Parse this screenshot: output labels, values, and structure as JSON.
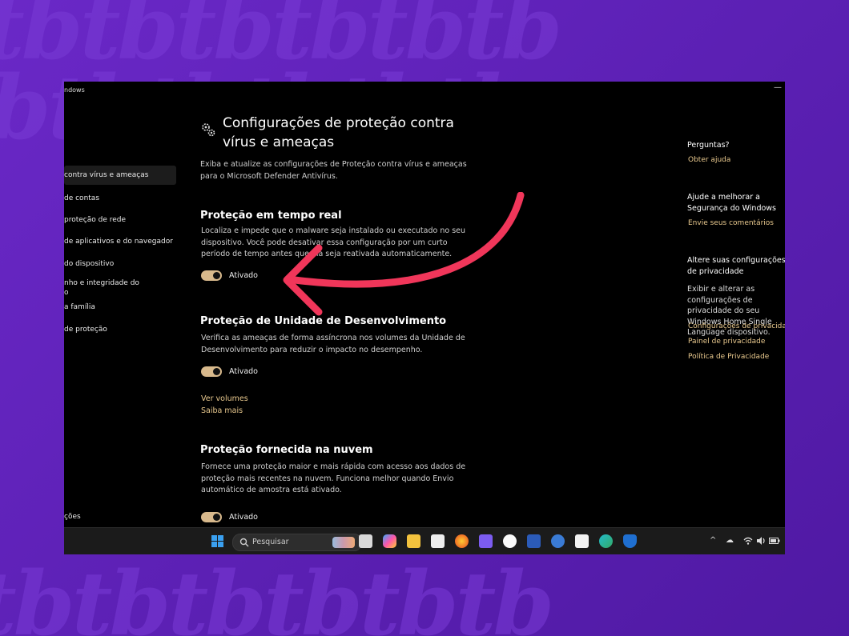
{
  "window": {
    "title": "ndows",
    "menu_glyph": "—"
  },
  "sidebar": {
    "items": [
      {
        "label": "contra vírus e ameaças",
        "active": true
      },
      {
        "label": "de contas"
      },
      {
        "label": "proteção de rede"
      },
      {
        "label": "de aplicativos e do navegador"
      },
      {
        "label": "do dispositivo"
      },
      {
        "label": "nho e integridade do o"
      },
      {
        "label": "a família"
      },
      {
        "label": "de proteção"
      }
    ],
    "bottom_item": "ções"
  },
  "main": {
    "title": "Configurações de proteção contra vírus e ameaças",
    "description": "Exiba e atualize as configurações de Proteção contra vírus e ameaças para o Microsoft Defender Antivírus.",
    "sections": [
      {
        "heading": "Proteção em tempo real",
        "text": "Localiza e impede que o malware seja instalado ou executado no seu dispositivo. Você pode desativar essa configuração por um curto período de tempo antes que ela seja reativada automaticamente.",
        "toggle_label": "Ativado",
        "toggle_on": true
      },
      {
        "heading": "Proteção de Unidade de Desenvolvimento",
        "text": "Verifica as ameaças de forma assíncrona nos volumes da Unidade de Desenvolvimento para reduzir o impacto no desempenho.",
        "toggle_label": "Ativado",
        "toggle_on": true,
        "links": [
          "Ver volumes",
          "Saiba mais"
        ]
      },
      {
        "heading": "Proteção fornecida na nuvem",
        "text": "Fornece uma proteção maior e mais rápida com acesso aos dados de proteção mais recentes na nuvem. Funciona melhor quando Envio automático de amostra está ativado.",
        "toggle_label": "Ativado",
        "toggle_on": true
      }
    ]
  },
  "right": {
    "questions_heading": "Perguntas?",
    "help_link": "Obter ajuda",
    "improve_heading": "Ajude a melhorar a Segurança do Windows",
    "feedback_link": "Envie seus comentários",
    "privacy_heading": "Altere suas configurações de privacidade",
    "privacy_text": "Exibir e alterar as configurações de privacidade do seu Windows Home Single Language dispositivo.",
    "privacy_links": [
      "Configurações de privacidade",
      "Painel de privacidade",
      "Política de Privacidade"
    ]
  },
  "taskbar": {
    "search_placeholder": "Pesquisar",
    "icons": [
      "windows-start-icon",
      "task-view-icon",
      "copilot-icon",
      "file-explorer-icon",
      "store-icon",
      "firefox-icon",
      "app-icon",
      "itunes-icon",
      "word-icon",
      "app2-icon",
      "app3-icon",
      "edge-icon",
      "defender-icon"
    ],
    "tray": [
      "^",
      "☁",
      "wifi",
      "vol",
      "bat"
    ]
  },
  "colors": {
    "accent": "#e9c98e",
    "toggle": "#d8b98c",
    "arrow": "#f0365a",
    "background": "#5a1fb0"
  }
}
